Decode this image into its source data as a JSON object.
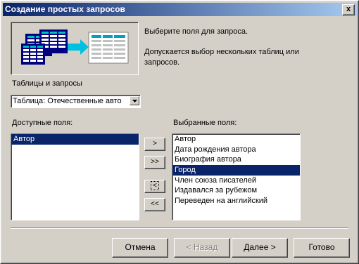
{
  "window": {
    "title": "Создание простых запросов",
    "close_glyph": "x"
  },
  "intro": {
    "line1": "Выберите поля для запроса.",
    "line2a": "Допускается выбор нескольких таблиц или",
    "line2b": "запросов."
  },
  "tables_label": "Таблицы и запросы",
  "combo": {
    "value": "Таблица: Отечественные авто"
  },
  "available": {
    "label": "Доступные поля:",
    "items": [
      "Автор"
    ],
    "selected_index": 0
  },
  "selected": {
    "label": "Выбранные поля:",
    "items": [
      "Автор",
      "Дата рождения автора",
      "Биография автора",
      "Город",
      "Член союза писателей",
      "Издавался за рубежом",
      "Переведен на английский"
    ],
    "selected_index": 3
  },
  "move_buttons": {
    "add": ">",
    "add_all": ">>",
    "remove": "<",
    "remove_all": "<<"
  },
  "buttons": {
    "cancel": "Отмена",
    "back": "< Назад",
    "next": "Далее >",
    "finish": "Готово"
  },
  "colors": {
    "titlebar_start": "#0a246a",
    "titlebar_end": "#a6caf0",
    "selection": "#0a246a",
    "face": "#d4d0c8"
  }
}
